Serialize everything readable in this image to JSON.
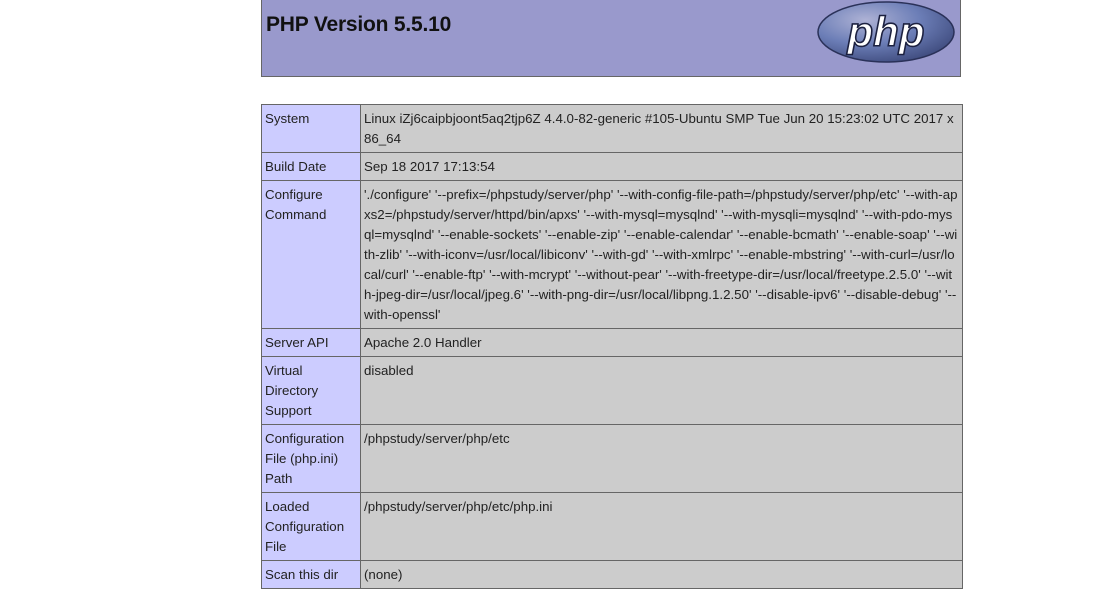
{
  "header": {
    "title": "PHP Version 5.5.10",
    "logo_text": "php"
  },
  "colors": {
    "header_bg": "#9999cc",
    "label_bg": "#ccccff",
    "value_bg": "#cccccc",
    "border": "#666666"
  },
  "rows": [
    {
      "key": "System",
      "value": "Linux iZj6caipbjoont5aq2tjp6Z 4.4.0-82-generic #105-Ubuntu SMP Tue Jun 20 15:23:02 UTC 2017 x86_64"
    },
    {
      "key": "Build Date",
      "value": "Sep 18 2017 17:13:54"
    },
    {
      "key": "Configure Command",
      "value": "'./configure' '--prefix=/phpstudy/server/php' '--with-config-file-path=/phpstudy/server/php/etc' '--with-apxs2=/phpstudy/server/httpd/bin/apxs' '--with-mysql=mysqlnd' '--with-mysqli=mysqlnd' '--with-pdo-mysql=mysqlnd' '--enable-sockets' '--enable-zip' '--enable-calendar' '--enable-bcmath' '--enable-soap' '--with-zlib' '--with-iconv=/usr/local/libiconv' '--with-gd' '--with-xmlrpc' '--enable-mbstring' '--with-curl=/usr/local/curl' '--enable-ftp' '--with-mcrypt' '--without-pear' '--with-freetype-dir=/usr/local/freetype.2.5.0' '--with-jpeg-dir=/usr/local/jpeg.6' '--with-png-dir=/usr/local/libpng.1.2.50' '--disable-ipv6' '--disable-debug' '--with-openssl'"
    },
    {
      "key": "Server API",
      "value": "Apache 2.0 Handler"
    },
    {
      "key": "Virtual Directory Support",
      "value": "disabled"
    },
    {
      "key": "Configuration File (php.ini) Path",
      "value": "/phpstudy/server/php/etc"
    },
    {
      "key": "Loaded Configuration File",
      "value": "/phpstudy/server/php/etc/php.ini"
    },
    {
      "key": "Scan this dir",
      "value": "(none)"
    }
  ]
}
